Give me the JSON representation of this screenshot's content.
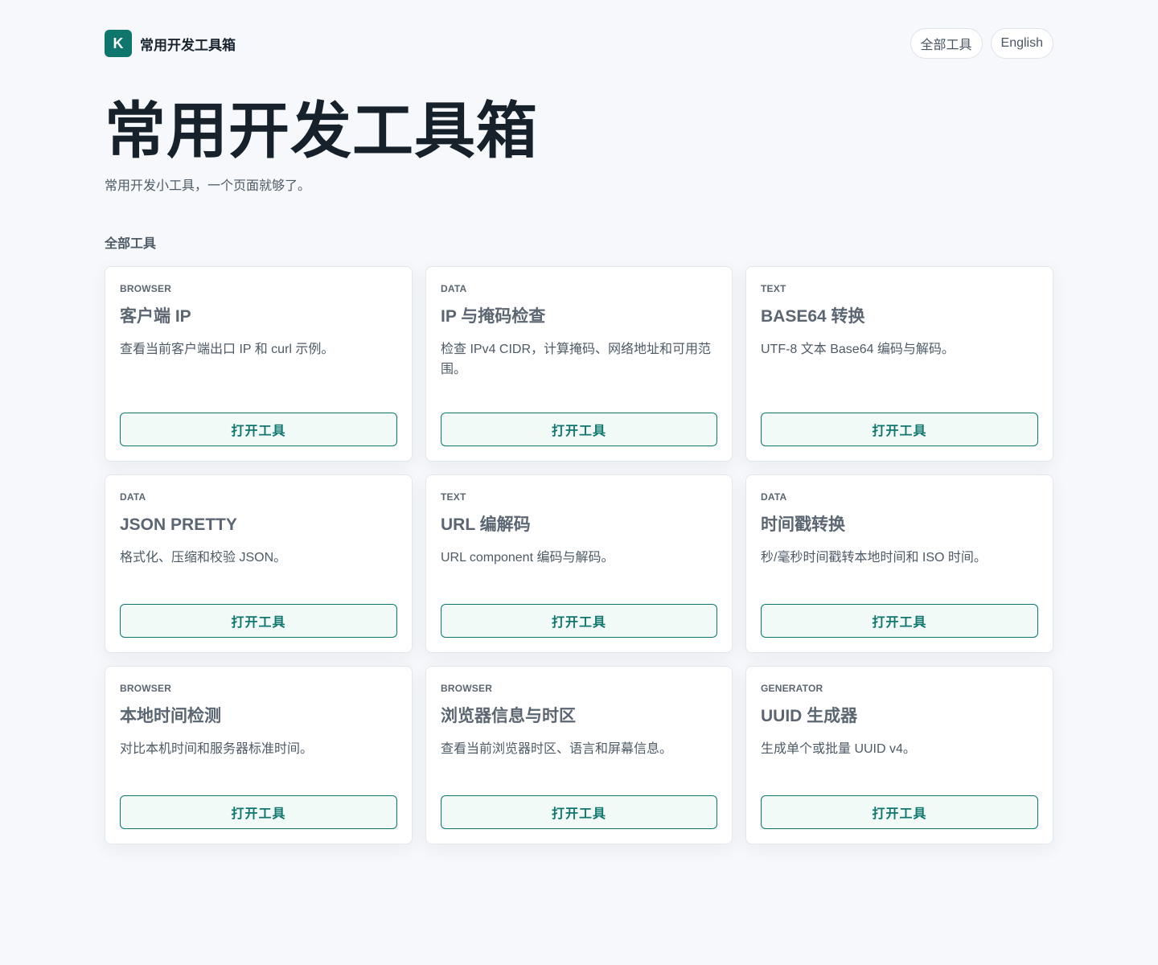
{
  "brand": {
    "logo_letter": "K",
    "name": "常用开发工具箱"
  },
  "nav": {
    "all_tools": "全部工具",
    "language": "English"
  },
  "hero": {
    "title": "常用开发工具箱",
    "subtitle": "常用开发小工具，一个页面就够了。"
  },
  "section": {
    "label": "全部工具"
  },
  "colors": {
    "accent": "#0f766e",
    "background": "#f6f8fb"
  },
  "cards": [
    {
      "tag": "BROWSER",
      "title": "客户端 IP",
      "desc": "查看当前客户端出口 IP 和 curl 示例。",
      "button": "打开工具"
    },
    {
      "tag": "DATA",
      "title": "IP 与掩码检查",
      "desc": "检查 IPv4 CIDR，计算掩码、网络地址和可用范围。",
      "button": "打开工具"
    },
    {
      "tag": "TEXT",
      "title": "BASE64 转换",
      "desc": "UTF-8 文本 Base64 编码与解码。",
      "button": "打开工具"
    },
    {
      "tag": "DATA",
      "title": "JSON PRETTY",
      "desc": "格式化、压缩和校验 JSON。",
      "button": "打开工具"
    },
    {
      "tag": "TEXT",
      "title": "URL 编解码",
      "desc": "URL component 编码与解码。",
      "button": "打开工具"
    },
    {
      "tag": "DATA",
      "title": "时间戳转换",
      "desc": "秒/毫秒时间戳转本地时间和 ISO 时间。",
      "button": "打开工具"
    },
    {
      "tag": "BROWSER",
      "title": "本地时间检测",
      "desc": "对比本机时间和服务器标准时间。",
      "button": "打开工具"
    },
    {
      "tag": "BROWSER",
      "title": "浏览器信息与时区",
      "desc": "查看当前浏览器时区、语言和屏幕信息。",
      "button": "打开工具"
    },
    {
      "tag": "GENERATOR",
      "title": "UUID 生成器",
      "desc": "生成单个或批量 UUID v4。",
      "button": "打开工具"
    }
  ]
}
